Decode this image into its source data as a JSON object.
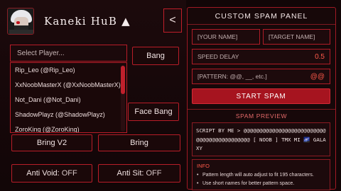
{
  "header": {
    "title": "Kaneki HuB ▲",
    "collapse_label": "<"
  },
  "player_select": {
    "placeholder": "Select Player...",
    "options": [
      "Rip_Leo (@Rip_Leo)",
      "XxNoobMasterX (@XxNoobMasterX)",
      "Not_Dani (@Not_Dani)",
      "ShadowPlayz (@ShadowPlayz)",
      "ZoroKing (@ZoroKing)"
    ]
  },
  "buttons": {
    "bang": "Bang",
    "face_bang": "Face Bang",
    "bring_v2": "Bring V2",
    "bring": "Bring"
  },
  "toggles": {
    "anti_void": {
      "label": "Anti Void:",
      "state": "OFF"
    },
    "anti_sit": {
      "label": "Anti Sit:",
      "state": "OFF"
    }
  },
  "spam_panel": {
    "title": "CUSTOM SPAM PANEL",
    "your_name_placeholder": "[YOUR NAME]",
    "target_name_placeholder": "[TARGET NAME]",
    "speed_label": "SPEED DELAY",
    "speed_value": "0.5",
    "pattern_placeholder": "[PATTERN: @@, __, etc.]",
    "pattern_value": "@@",
    "start_label": "START SPAM",
    "preview_title": "SPAM PREVIEW",
    "preview_text": "SCRIPT BY ME > @@@@@@@@@@@@@@@@@@@@@@@@@@@@@@@@@@@@@@@@@@@ [ NOOB ] TMX MI 🌌 GALAXY",
    "info_title": "INFO",
    "info_lines": [
      "Pattern length will auto adjust to fit 195 characters.",
      "Use short names for better pattern space."
    ]
  },
  "colors": {
    "accent": "#b81d28",
    "button_fill": "#a6141f",
    "highlight": "#ff5a4a",
    "background": "#120607"
  }
}
